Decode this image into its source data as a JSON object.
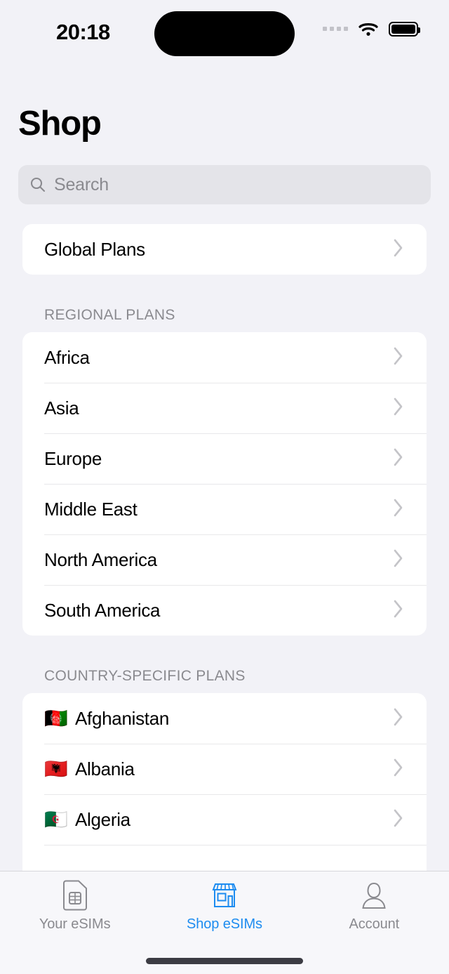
{
  "status_bar": {
    "time": "20:18",
    "cellular_icon": "cellular-dots-icon",
    "wifi_icon": "wifi-icon",
    "battery_icon": "battery-icon"
  },
  "header": {
    "title": "Shop"
  },
  "search": {
    "icon": "search-icon",
    "placeholder": "Search",
    "value": ""
  },
  "global": {
    "label": "Global Plans"
  },
  "sections": [
    {
      "header": "REGIONAL PLANS",
      "items": [
        {
          "label": "Africa"
        },
        {
          "label": "Asia"
        },
        {
          "label": "Europe"
        },
        {
          "label": "Middle East"
        },
        {
          "label": "North America"
        },
        {
          "label": "South America"
        }
      ]
    },
    {
      "header": "COUNTRY-SPECIFIC PLANS",
      "items": [
        {
          "flag": "🇦🇫",
          "label": "Afghanistan"
        },
        {
          "flag": "🇦🇱",
          "label": "Albania"
        },
        {
          "flag": "🇩🇿",
          "label": "Algeria"
        }
      ]
    }
  ],
  "tab_bar": {
    "active_color": "#1d8cf0",
    "inactive_color": "#8a8a8f",
    "tabs": [
      {
        "label": "Your eSIMs",
        "icon": "sim-card-icon",
        "active": false
      },
      {
        "label": "Shop eSIMs",
        "icon": "storefront-icon",
        "active": true
      },
      {
        "label": "Account",
        "icon": "person-icon",
        "active": false
      }
    ]
  },
  "colors": {
    "background": "#f2f2f7",
    "card": "#ffffff",
    "search_field": "#e4e4e9",
    "separator": "#e8e8ea",
    "secondary_text": "#8a8a8f",
    "accent": "#1d8cf0"
  }
}
